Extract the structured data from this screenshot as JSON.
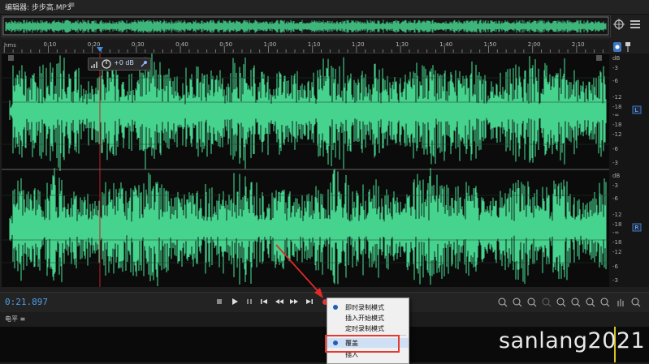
{
  "panel": {
    "title": "编辑器: 步步高.MP3",
    "menu_icon": "≡"
  },
  "ruler": {
    "unit": "hms",
    "ticks": [
      "0:10",
      "0:20",
      "0:30",
      "0:40",
      "0:50",
      "1:00",
      "1:10",
      "1:20",
      "1:30",
      "1:40",
      "1:50",
      "2:00",
      "2:10"
    ]
  },
  "db_scale": {
    "unit": "dB",
    "labels": [
      "-3",
      "-6",
      "-12",
      "-18",
      "-∞",
      "-18",
      "-12",
      "-6",
      "-3"
    ],
    "channel_top": "L",
    "channel_bottom": "R"
  },
  "hud": {
    "gain": "+0 dB"
  },
  "transport": {
    "timecode": "0:21.897"
  },
  "context_menu": {
    "items": [
      {
        "label": "即时录制模式",
        "checked": true
      },
      {
        "label": "插入开始模式",
        "checked": false
      },
      {
        "label": "定时录制模式",
        "checked": false
      },
      {
        "label": "覆盖",
        "checked": true
      },
      {
        "label": "插入",
        "checked": false
      }
    ]
  },
  "levels": {
    "title": "电平",
    "menu_icon": "≡"
  },
  "watermark": "sanlang2021",
  "colors": {
    "waveform": "#46d38e",
    "playhead": "#c0202a",
    "timecode": "#4e9fe6",
    "highlight": "#e53a32"
  }
}
